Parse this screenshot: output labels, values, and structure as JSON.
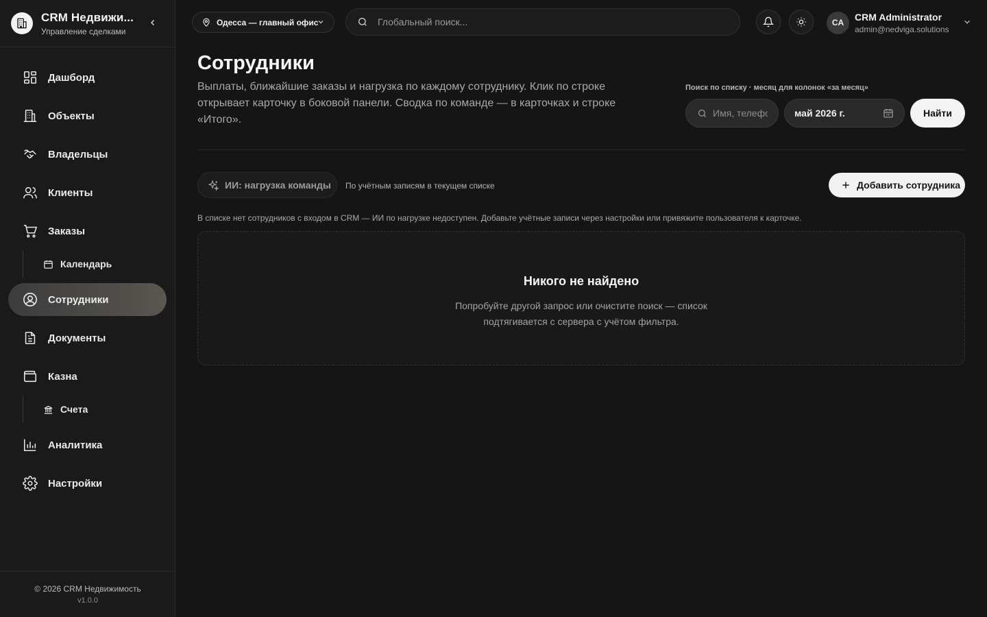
{
  "sidebar": {
    "brand_title": "CRM Недвижи...",
    "brand_subtitle": "Управление сделками",
    "items": [
      {
        "label": "Дашборд",
        "icon": "dashboard-icon"
      },
      {
        "label": "Объекты",
        "icon": "building-icon"
      },
      {
        "label": "Владельцы",
        "icon": "handshake-icon"
      },
      {
        "label": "Клиенты",
        "icon": "users-icon"
      },
      {
        "label": "Заказы",
        "icon": "cart-icon"
      },
      {
        "label": "Календарь",
        "icon": "calendar-icon",
        "sub": true
      },
      {
        "label": "Сотрудники",
        "icon": "user-circle-icon",
        "active": true
      },
      {
        "label": "Документы",
        "icon": "document-icon"
      },
      {
        "label": "Казна",
        "icon": "wallet-icon"
      },
      {
        "label": "Счета",
        "icon": "bank-icon",
        "sub": true
      },
      {
        "label": "Аналитика",
        "icon": "bar-chart-icon"
      },
      {
        "label": "Настройки",
        "icon": "gear-icon"
      }
    ],
    "footer_copyright": "© 2026 CRM Недвижимость",
    "footer_version": "v1.0.0"
  },
  "header": {
    "office": "Одесса — главный офис",
    "search_placeholder": "Глобальный поиск...",
    "user_initials": "CA",
    "user_name": "CRM Administrator",
    "user_email": "admin@nedviga.solutions"
  },
  "page": {
    "title": "Сотрудники",
    "description": "Выплаты, ближайшие заказы и нагрузка по каждому сотруднику. Клик по строке открывает карточку в боковой панели. Сводка по команде — в карточках и строке «Итого».",
    "filter_caption": "Поиск по списку · месяц для колонок «за месяц»",
    "list_search_placeholder": "Имя, телефон",
    "month_value": "май 2026 г.",
    "find_label": "Найти",
    "ai_label": "ИИ: нагрузка команды",
    "ai_note": "По учётным записям в текущем списке",
    "add_label": "Добавить сотрудника",
    "warning": "В списке нет сотрудников с входом в CRM — ИИ по нагрузке недоступен. Добавьте учётные записи через настройки или привяжите пользователя к карточке.",
    "empty_title": "Никого не найдено",
    "empty_text": "Попробуйте другой запрос или очистите поиск — список подтягивается с сервера с учётом фильтра."
  },
  "colors": {
    "background": "#151515",
    "sidebar": "#1a1a1a",
    "accent_button": "#f4f4f4"
  }
}
